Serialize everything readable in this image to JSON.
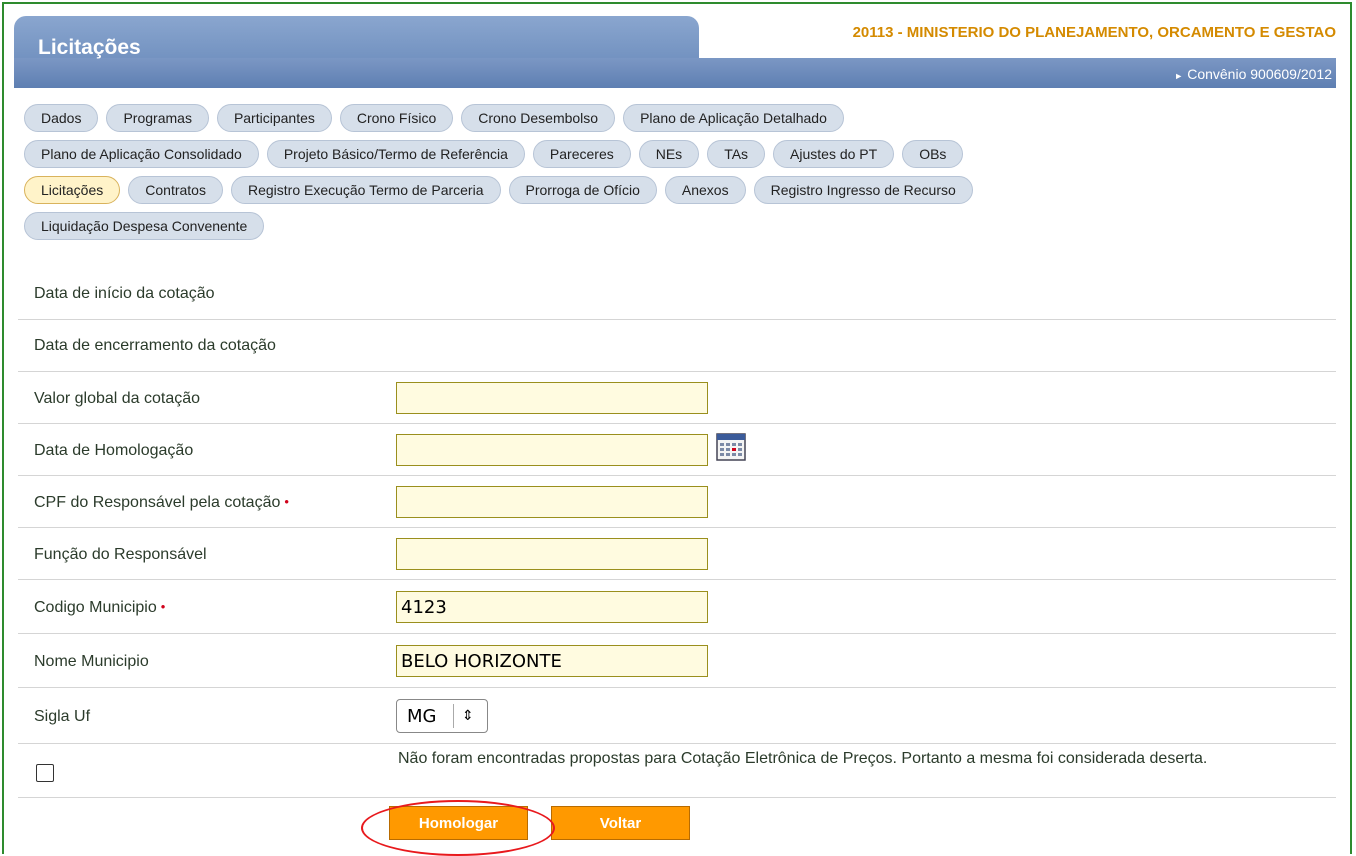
{
  "header": {
    "title": "Licitações",
    "organization": "20113 - MINISTERIO DO PLANEJAMENTO, ORCAMENTO E GESTAO",
    "convenio": "Convênio 900609/2012"
  },
  "tabs": {
    "row1": [
      "Dados",
      "Programas",
      "Participantes",
      "Crono Físico",
      "Crono Desembolso",
      "Plano de Aplicação Detalhado"
    ],
    "row2": [
      "Plano de Aplicação Consolidado",
      "Projeto Básico/Termo de Referência",
      "Pareceres",
      "NEs",
      "TAs",
      "Ajustes do PT",
      "OBs"
    ],
    "row3": [
      "Licitações",
      "Contratos",
      "Registro Execução Termo de Parceria",
      "Prorroga de Ofício",
      "Anexos",
      "Registro Ingresso de Recurso"
    ],
    "row4": [
      "Liquidação Despesa Convenente"
    ],
    "active": "Licitações"
  },
  "form": {
    "data_inicio_label": "Data de início da cotação",
    "data_encerramento_label": "Data de encerramento da cotação",
    "valor_global_label": "Valor global da cotação",
    "valor_global_value": "",
    "data_homologacao_label": "Data de Homologação",
    "data_homologacao_value": "",
    "cpf_label": "CPF do Responsável pela cotação",
    "cpf_value": "",
    "funcao_label": "Função do Responsável",
    "funcao_value": "",
    "codigo_municipio_label": "Codigo Municipio",
    "codigo_municipio_value": "4123",
    "nome_municipio_label": "Nome Municipio",
    "nome_municipio_value": "BELO HORIZONTE",
    "sigla_uf_label": "Sigla Uf",
    "sigla_uf_value": "MG",
    "required_mark": "•",
    "deserta_text": "Não foram encontradas propostas para Cotação Eletrônica de Preços. Portanto a mesma foi considerada deserta."
  },
  "buttons": {
    "homologar": "Homologar",
    "voltar": "Voltar"
  },
  "colors": {
    "accent_orange": "#ff9900",
    "header_blue": "#6f8fbe",
    "org_text": "#d48a00",
    "highlight_circle": "#e8191d"
  },
  "icons": {
    "calendar": "calendar-icon",
    "select_arrows": "updown-chevron-icon",
    "convenio_arrow": "triangle-right-icon"
  }
}
